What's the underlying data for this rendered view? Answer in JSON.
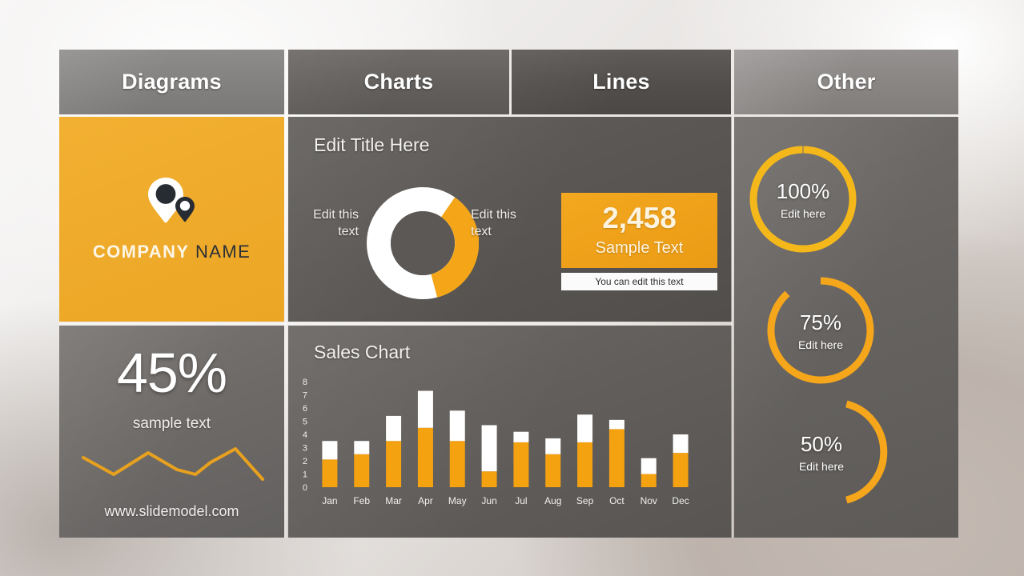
{
  "theme": {
    "orange": "#efab2b",
    "orange_bar": "#f5a210",
    "orange_gauge": "#f5a91b",
    "panel_gray": "#5f5c59",
    "tab_gray": "#83817f",
    "white": "#ffffff"
  },
  "tabs": [
    {
      "label": "Diagrams"
    },
    {
      "label": "Charts"
    },
    {
      "label": "Lines"
    },
    {
      "label": "Other"
    }
  ],
  "company": {
    "name_first": "COMPANY",
    "name_second": "NAME",
    "logo_icon": "location-pin-logo-icon"
  },
  "chart_card": {
    "title": "Edit Title Here",
    "donut_label_left": "Edit this text",
    "donut_label_right": "Edit this text",
    "stat_value": "2,458",
    "stat_caption": "Sample Text",
    "stat_note": "You can edit this text"
  },
  "percent_card": {
    "value": "45%",
    "caption": "sample text",
    "url": "www.slidemodel.com"
  },
  "gauges": [
    {
      "percent": "100%",
      "caption": "Edit here",
      "value": 100
    },
    {
      "percent": "75%",
      "caption": "Edit here",
      "value": 75
    },
    {
      "percent": "50%",
      "caption": "Edit here",
      "value": 50
    }
  ],
  "chart_data": [
    {
      "type": "pie",
      "name": "donut",
      "title": "Edit Title Here",
      "labels": [
        "Edit this text",
        "Edit this text"
      ],
      "values": [
        64,
        36
      ],
      "colors": [
        "#ffffff",
        "#f5a618"
      ],
      "hole": 0.52
    },
    {
      "type": "bar",
      "name": "sales-chart",
      "title": "Sales Chart",
      "stacked": true,
      "categories": [
        "Jan",
        "Feb",
        "Mar",
        "Apr",
        "May",
        "Jun",
        "Jul",
        "Aug",
        "Sep",
        "Oct",
        "Nov",
        "Dec"
      ],
      "series": [
        {
          "name": "Orange",
          "color": "#f5a210",
          "values": [
            2.1,
            2.5,
            3.5,
            4.5,
            3.5,
            1.2,
            3.4,
            2.5,
            3.4,
            4.4,
            1.0,
            2.6
          ]
        },
        {
          "name": "White",
          "color": "#ffffff",
          "values": [
            1.4,
            1.0,
            1.9,
            2.8,
            2.3,
            3.5,
            0.8,
            1.2,
            2.1,
            0.7,
            1.2,
            1.4
          ]
        }
      ],
      "ylim": [
        0,
        8
      ],
      "yticks": [
        0,
        1,
        2,
        3,
        4,
        5,
        6,
        7,
        8
      ],
      "xlabel": "",
      "ylabel": "",
      "grid": false,
      "legend": false
    },
    {
      "type": "line",
      "name": "sparkline",
      "color": "#e8a11e",
      "points": [
        [
          0,
          62
        ],
        [
          17,
          30
        ],
        [
          36,
          72
        ],
        [
          52,
          38
        ],
        [
          62,
          30
        ],
        [
          70,
          56
        ],
        [
          84,
          88
        ],
        [
          100,
          18
        ]
      ],
      "ylim": [
        0,
        100
      ],
      "grid": false,
      "legend": false
    }
  ]
}
